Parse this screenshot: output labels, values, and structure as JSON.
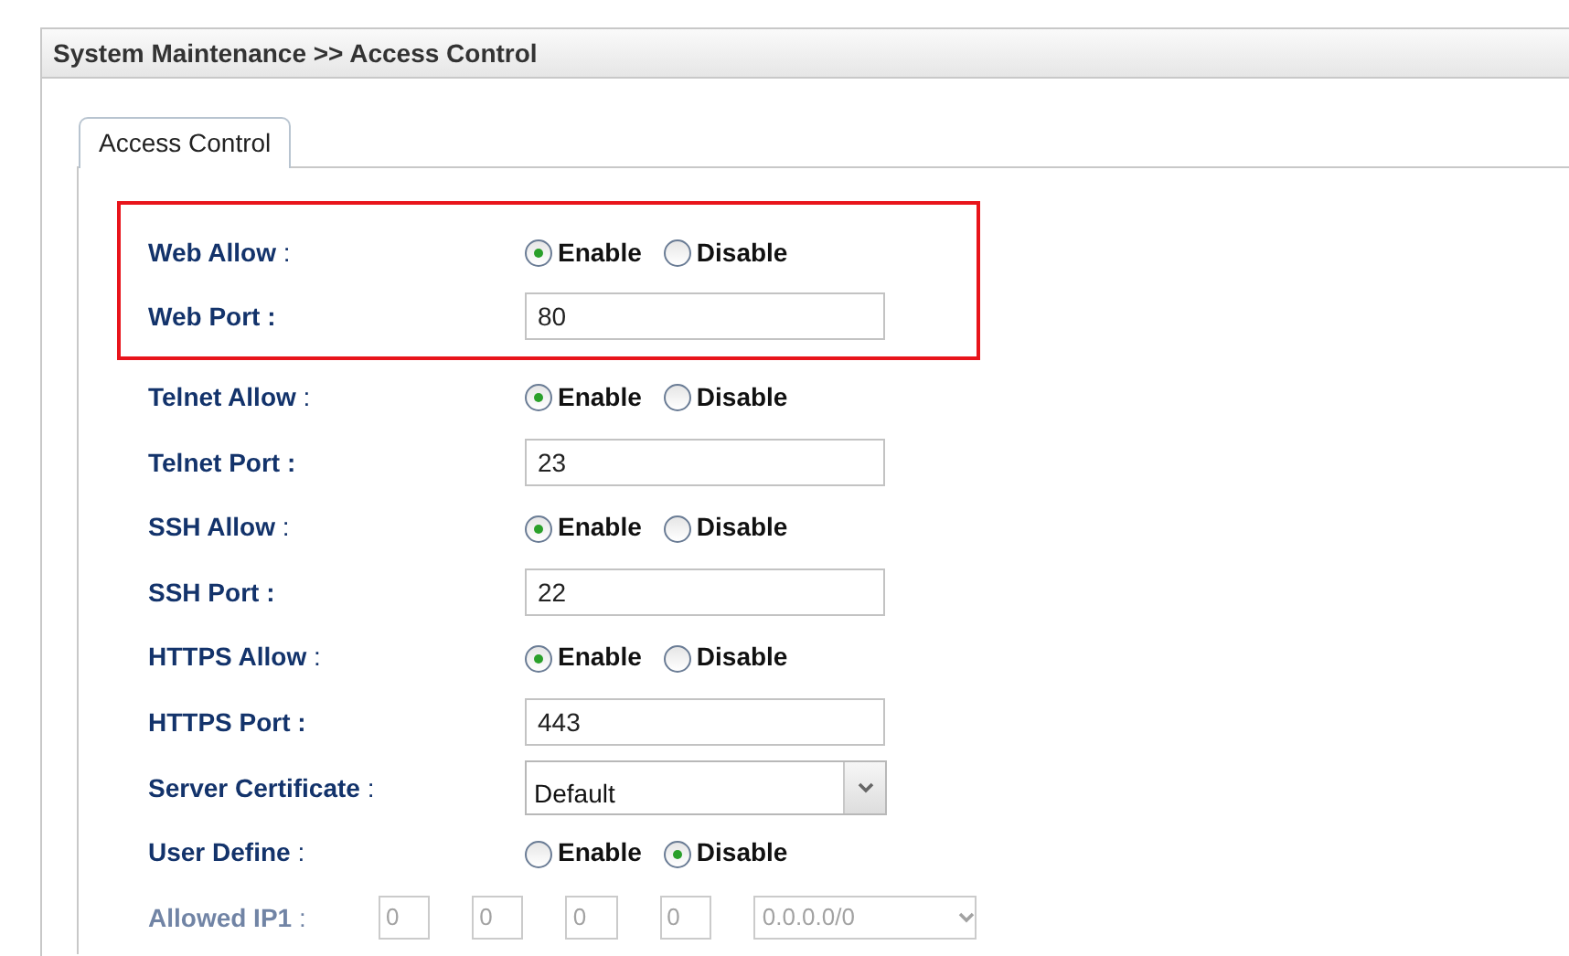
{
  "header": {
    "title": "System Maintenance >> Access Control"
  },
  "tabs": [
    {
      "label": "Access Control",
      "selected": true
    }
  ],
  "sections": [
    {
      "highlighted": true,
      "rows": [
        {
          "kind": "radio",
          "label": "**Web Allow** :",
          "options": [
            {
              "label": "Enable",
              "selected": true
            },
            {
              "label": "Disable",
              "selected": false
            }
          ]
        },
        {
          "kind": "text",
          "label": "**Web Port :**",
          "value": "80"
        }
      ]
    },
    {
      "highlighted": false,
      "rows": [
        {
          "kind": "radio",
          "label": "**Telnet Allow** :",
          "options": [
            {
              "label": "Enable",
              "selected": true
            },
            {
              "label": "Disable",
              "selected": false
            }
          ]
        },
        {
          "kind": "text",
          "label": "**Telnet Port :**",
          "value": "23"
        },
        {
          "kind": "radio",
          "label": "**SSH Allow** :",
          "options": [
            {
              "label": "Enable",
              "selected": true
            },
            {
              "label": "Disable",
              "selected": false
            }
          ]
        },
        {
          "kind": "text",
          "label": "**SSH Port :**",
          "value": "22"
        },
        {
          "kind": "radio",
          "label": "**HTTPS Allow** :",
          "options": [
            {
              "label": "Enable",
              "selected": true
            },
            {
              "label": "Disable",
              "selected": false
            }
          ]
        },
        {
          "kind": "text",
          "label": "**HTTPS Port :**",
          "value": "443"
        },
        {
          "kind": "select",
          "label": "**Server Certificate** :",
          "value": "Default"
        },
        {
          "kind": "radio",
          "label": "**User Define** :",
          "options": [
            {
              "label": "Enable",
              "selected": false
            },
            {
              "label": "Disable",
              "selected": true
            }
          ]
        },
        {
          "kind": "ip",
          "label": "**Allowed IP1** :",
          "octets": [
            "0",
            "0",
            "0",
            "0"
          ],
          "value": "0.0.0.0/0"
        }
      ]
    }
  ]
}
